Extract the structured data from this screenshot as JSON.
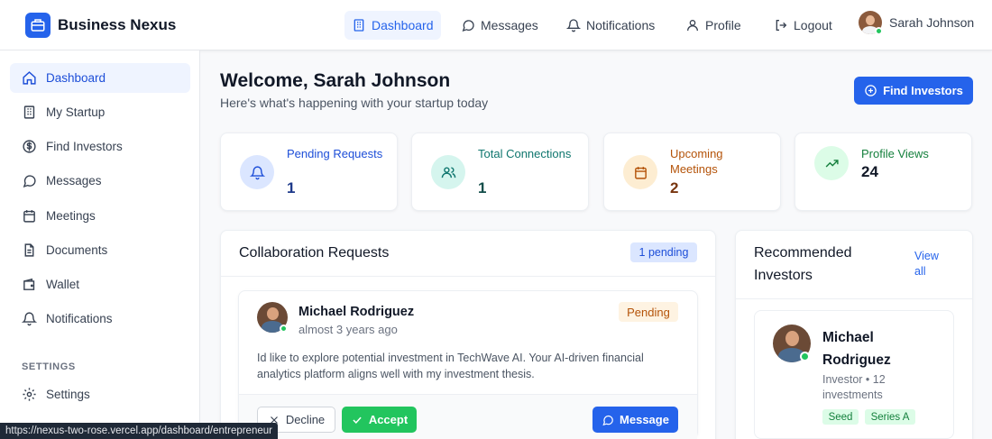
{
  "brand": {
    "name": "Business Nexus",
    "color": "#2563eb"
  },
  "topnav": {
    "items": [
      {
        "label": "Dashboard",
        "icon": "building-icon",
        "active": true
      },
      {
        "label": "Messages",
        "icon": "message-icon"
      },
      {
        "label": "Notifications",
        "icon": "bell-icon"
      },
      {
        "label": "Profile",
        "icon": "user-icon"
      },
      {
        "label": "Logout",
        "icon": "logout-icon"
      }
    ],
    "user_name": "Sarah Johnson"
  },
  "sidebar": {
    "items": [
      {
        "label": "Dashboard",
        "icon": "home-icon",
        "active": true
      },
      {
        "label": "My Startup",
        "icon": "building-icon"
      },
      {
        "label": "Find Investors",
        "icon": "dollar-circle-icon"
      },
      {
        "label": "Messages",
        "icon": "message-icon"
      },
      {
        "label": "Meetings",
        "icon": "calendar-icon"
      },
      {
        "label": "Documents",
        "icon": "document-icon"
      },
      {
        "label": "Wallet",
        "icon": "wallet-icon"
      },
      {
        "label": "Notifications",
        "icon": "bell-icon"
      }
    ],
    "section_label": "SETTINGS",
    "settings_item": {
      "label": "Settings",
      "icon": "gear-icon"
    }
  },
  "header": {
    "title": "Welcome, Sarah Johnson",
    "subtitle": "Here's what's happening with your startup today",
    "find_investors_button": "Find Investors"
  },
  "stats": [
    {
      "label": "Pending Requests",
      "value": "1",
      "color": "#1d4ed8",
      "bg": "#dbe6ff",
      "icon": "bell-icon"
    },
    {
      "label": "Total Connections",
      "value": "1",
      "color": "#0f766e",
      "bg": "#d5f5ee",
      "icon": "users-icon"
    },
    {
      "label": "Upcoming Meetings",
      "value": "2",
      "color": "#b45309",
      "bg": "#fdedd2",
      "icon": "calendar-icon"
    },
    {
      "label": "Profile Views",
      "value": "24",
      "color": "#15803d",
      "bg": "#dcfce7",
      "icon": "trending-up-icon"
    }
  ],
  "collab": {
    "title": "Collaboration Requests",
    "badge": "1 pending",
    "request": {
      "name": "Michael Rodriguez",
      "time": "almost 3 years ago",
      "status": "Pending",
      "message": "Id like to explore potential investment in TechWave AI. Your AI-driven financial analytics platform aligns well with my investment thesis.",
      "decline_label": "Decline",
      "accept_label": "Accept",
      "message_label": "Message"
    }
  },
  "recommended": {
    "title": "Recommended Investors",
    "view_all": "View all",
    "investor": {
      "name": "Michael Rodriguez",
      "meta": "Investor • 12 investments",
      "tags": [
        "Seed",
        "Series A"
      ]
    }
  },
  "statusbar": {
    "url": "https://nexus-two-rose.vercel.app/dashboard/entrepreneur"
  }
}
